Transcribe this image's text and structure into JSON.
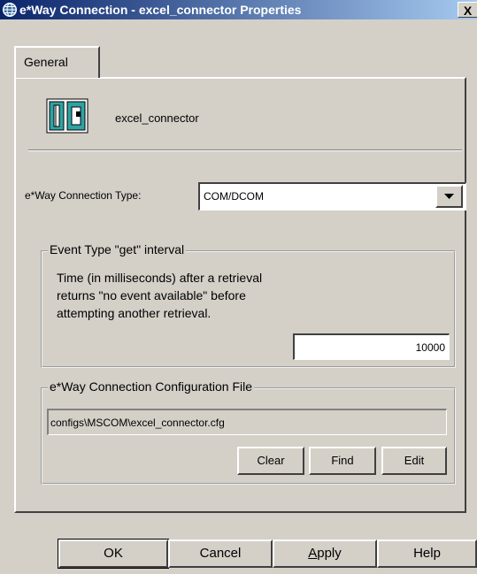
{
  "window": {
    "title": "e*Way Connection - excel_connector Properties",
    "close_label": "X"
  },
  "tabs": [
    {
      "label": "General"
    }
  ],
  "general": {
    "component_name": "excel_connector",
    "connection_type_label": "e*Way Connection Type:",
    "connection_type_value": "COM/DCOM",
    "interval_group_title": "Event Type \"get\" interval",
    "interval_description_lines": [
      "Time (in milliseconds) after a retrieval",
      "returns \"no event available\" before",
      "attempting another retrieval."
    ],
    "interval_value": "10000",
    "config_group_title": "e*Way Connection Configuration File",
    "config_path": "configs\\MSCOM\\excel_connector.cfg",
    "clear_label": "Clear",
    "find_label": "Find",
    "edit_label": "Edit"
  },
  "footer": {
    "ok_label": "OK",
    "cancel_label": "Cancel",
    "apply_label": "Apply",
    "apply_mnemonic": "A",
    "apply_rest": "pply",
    "help_label": "Help"
  },
  "icons": [
    "window-globe-icon",
    "connector-icon",
    "dropdown-arrow-icon"
  ],
  "colors": {
    "face": "#d4d0c8",
    "title_start": "#0a246a",
    "title_end": "#a6caf0"
  }
}
